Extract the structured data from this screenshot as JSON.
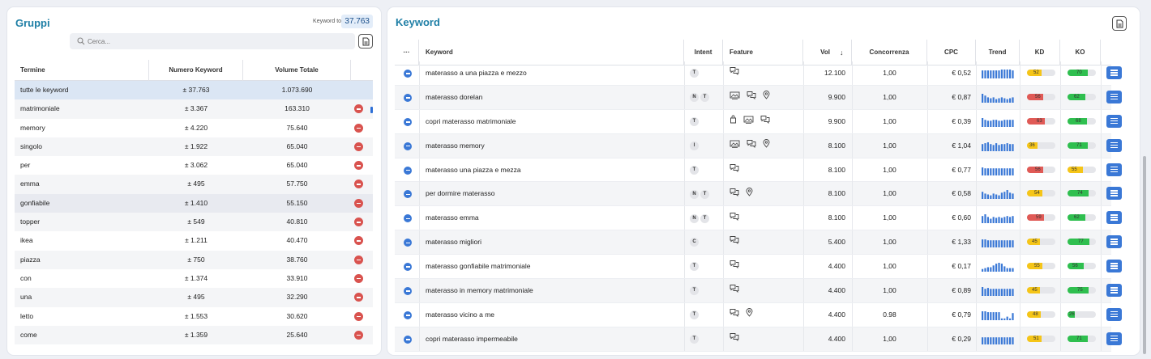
{
  "groups": {
    "title": "Gruppi",
    "total_label": "Keyword totali",
    "total_value": "37.763",
    "search_placeholder": "Cerca...",
    "columns": [
      "Termine",
      "Numero Keyword",
      "Volume Totale"
    ],
    "rows": [
      {
        "term": "tutte le keyword",
        "count": "± 37.763",
        "volume": "1.073.690",
        "removable": false
      },
      {
        "term": "matrimoniale",
        "count": "± 3.367",
        "volume": "163.310",
        "removable": true
      },
      {
        "term": "memory",
        "count": "± 4.220",
        "volume": "75.640",
        "removable": true
      },
      {
        "term": "singolo",
        "count": "± 1.922",
        "volume": "65.040",
        "removable": true
      },
      {
        "term": "per",
        "count": "± 3.062",
        "volume": "65.040",
        "removable": true
      },
      {
        "term": "emma",
        "count": "± 495",
        "volume": "57.750",
        "removable": true
      },
      {
        "term": "gonfiabile",
        "count": "± 1.410",
        "volume": "55.150",
        "removable": true
      },
      {
        "term": "topper",
        "count": "± 549",
        "volume": "40.810",
        "removable": true
      },
      {
        "term": "ikea",
        "count": "± 1.211",
        "volume": "40.470",
        "removable": true
      },
      {
        "term": "piazza",
        "count": "± 750",
        "volume": "38.760",
        "removable": true
      },
      {
        "term": "con",
        "count": "± 1.374",
        "volume": "33.910",
        "removable": true
      },
      {
        "term": "una",
        "count": "± 495",
        "volume": "32.290",
        "removable": true
      },
      {
        "term": "letto",
        "count": "± 1.553",
        "volume": "30.620",
        "removable": true
      },
      {
        "term": "come",
        "count": "± 1.359",
        "volume": "25.640",
        "removable": true
      }
    ]
  },
  "keywords": {
    "title": "Keyword",
    "columns": {
      "more": "···",
      "keyword": "Keyword",
      "intent": "Intent",
      "feature": "Feature",
      "vol": "Vol",
      "sort_arrow": "↓",
      "competition": "Concorrenza",
      "cpc": "CPC",
      "trend": "Trend",
      "kd": "KD",
      "ko": "KO"
    },
    "colors": {
      "kd_red": "#e05a56",
      "kd_yellow": "#f5c518",
      "ko_green": "#2fbf4f",
      "ko_yellow": "#f5c518",
      "trend_blue": "#3a78d6"
    },
    "rows": [
      {
        "keyword": "materasso a una piazza e mezzo",
        "intent": [
          "T"
        ],
        "features": [
          "chat-bubbles-icon"
        ],
        "vol": "12.100",
        "comp": "1,00",
        "cpc": "€ 0,52",
        "trend": [
          9,
          9,
          9,
          9,
          9,
          9,
          9,
          10,
          10,
          10,
          10,
          9
        ],
        "kd": 52,
        "kd_color": "yellow",
        "ko": 70,
        "ko_color": "green"
      },
      {
        "keyword": "materasso dorelan",
        "intent": [
          "N",
          "T"
        ],
        "features": [
          "image-gallery-icon",
          "chat-bubbles-icon",
          "map-pin-icon"
        ],
        "vol": "9.900",
        "comp": "1,00",
        "cpc": "€ 0,87",
        "trend": [
          10,
          8,
          6,
          5,
          6,
          4,
          5,
          6,
          5,
          4,
          5,
          6
        ],
        "kd": 56,
        "kd_color": "red",
        "ko": 62,
        "ko_color": "green"
      },
      {
        "keyword": "copri materasso matrimoniale",
        "intent": [
          "T"
        ],
        "features": [
          "shopping-bag-icon",
          "image-gallery-icon",
          "chat-bubbles-icon"
        ],
        "vol": "9.900",
        "comp": "1,00",
        "cpc": "€ 0,39",
        "trend": [
          10,
          8,
          7,
          7,
          8,
          8,
          7,
          7,
          8,
          8,
          8,
          8
        ],
        "kd": 63,
        "kd_color": "red",
        "ko": 68,
        "ko_color": "green"
      },
      {
        "keyword": "materasso memory",
        "intent": [
          "I"
        ],
        "features": [
          "image-gallery-icon",
          "chat-bubbles-icon",
          "map-pin-icon"
        ],
        "vol": "8.100",
        "comp": "1,00",
        "cpc": "€ 1,04",
        "trend": [
          8,
          9,
          10,
          8,
          7,
          9,
          7,
          8,
          8,
          9,
          8,
          8
        ],
        "kd": 36,
        "kd_color": "yellow",
        "ko": 71,
        "ko_color": "green"
      },
      {
        "keyword": "materasso una piazza e mezza",
        "intent": [
          "T"
        ],
        "features": [
          "chat-bubbles-icon"
        ],
        "vol": "8.100",
        "comp": "1,00",
        "cpc": "€ 0,77",
        "trend": [
          9,
          8,
          8,
          8,
          8,
          8,
          8,
          8,
          8,
          8,
          8,
          8
        ],
        "kd": 56,
        "kd_color": "red",
        "ko": 55,
        "ko_color": "yellow"
      },
      {
        "keyword": "per dormire materasso",
        "intent": [
          "N",
          "T"
        ],
        "features": [
          "chat-bubbles-icon",
          "map-pin-icon"
        ],
        "vol": "8.100",
        "comp": "1,00",
        "cpc": "€ 0,58",
        "trend": [
          8,
          6,
          5,
          4,
          6,
          5,
          4,
          7,
          8,
          10,
          7,
          6
        ],
        "kd": 54,
        "kd_color": "yellow",
        "ko": 74,
        "ko_color": "green"
      },
      {
        "keyword": "materasso emma",
        "intent": [
          "N",
          "T"
        ],
        "features": [
          "chat-bubbles-icon"
        ],
        "vol": "8.100",
        "comp": "1,00",
        "cpc": "€ 0,60",
        "trend": [
          8,
          10,
          7,
          5,
          7,
          6,
          7,
          6,
          7,
          8,
          7,
          8
        ],
        "kd": 59,
        "kd_color": "red",
        "ko": 62,
        "ko_color": "green"
      },
      {
        "keyword": "materasso migliori",
        "intent": [
          "C"
        ],
        "features": [
          "chat-bubbles-icon"
        ],
        "vol": "5.400",
        "comp": "1,00",
        "cpc": "€ 1,33",
        "trend": [
          9,
          9,
          8,
          8,
          8,
          8,
          8,
          8,
          8,
          8,
          8,
          8
        ],
        "kd": 45,
        "kd_color": "yellow",
        "ko": 77,
        "ko_color": "green"
      },
      {
        "keyword": "materasso gonfiabile matrimoniale",
        "intent": [
          "T"
        ],
        "features": [
          "chat-bubbles-icon"
        ],
        "vol": "4.400",
        "comp": "1,00",
        "cpc": "€ 0,17",
        "trend": [
          3,
          4,
          5,
          5,
          7,
          9,
          10,
          9,
          6,
          4,
          4,
          4
        ],
        "kd": 55,
        "kd_color": "yellow",
        "ko": 56,
        "ko_color": "green"
      },
      {
        "keyword": "materasso in memory matrimoniale",
        "intent": [
          "T"
        ],
        "features": [
          "chat-bubbles-icon"
        ],
        "vol": "4.400",
        "comp": "1,00",
        "cpc": "€ 0,89",
        "trend": [
          10,
          8,
          9,
          8,
          8,
          8,
          8,
          8,
          8,
          8,
          8,
          8
        ],
        "kd": 45,
        "kd_color": "yellow",
        "ko": 75,
        "ko_color": "green"
      },
      {
        "keyword": "materasso vicino a me",
        "intent": [
          "T"
        ],
        "features": [
          "chat-bubbles-icon",
          "map-pin-icon"
        ],
        "vol": "4.400",
        "comp": "0.98",
        "cpc": "€ 0,79",
        "trend": [
          10,
          10,
          9,
          9,
          9,
          9,
          9,
          2,
          2,
          4,
          2,
          8
        ],
        "kd": 48,
        "kd_color": "yellow",
        "ko": 26,
        "ko_color": "green"
      },
      {
        "keyword": "copri materasso impermeabile",
        "intent": [
          "T"
        ],
        "features": [
          "chat-bubbles-icon"
        ],
        "vol": "4.400",
        "comp": "1,00",
        "cpc": "€ 0,29",
        "trend": [
          8,
          8,
          8,
          8,
          8,
          8,
          8,
          8,
          8,
          8,
          8,
          8
        ],
        "kd": 51,
        "kd_color": "yellow",
        "ko": 71,
        "ko_color": "green"
      }
    ]
  }
}
